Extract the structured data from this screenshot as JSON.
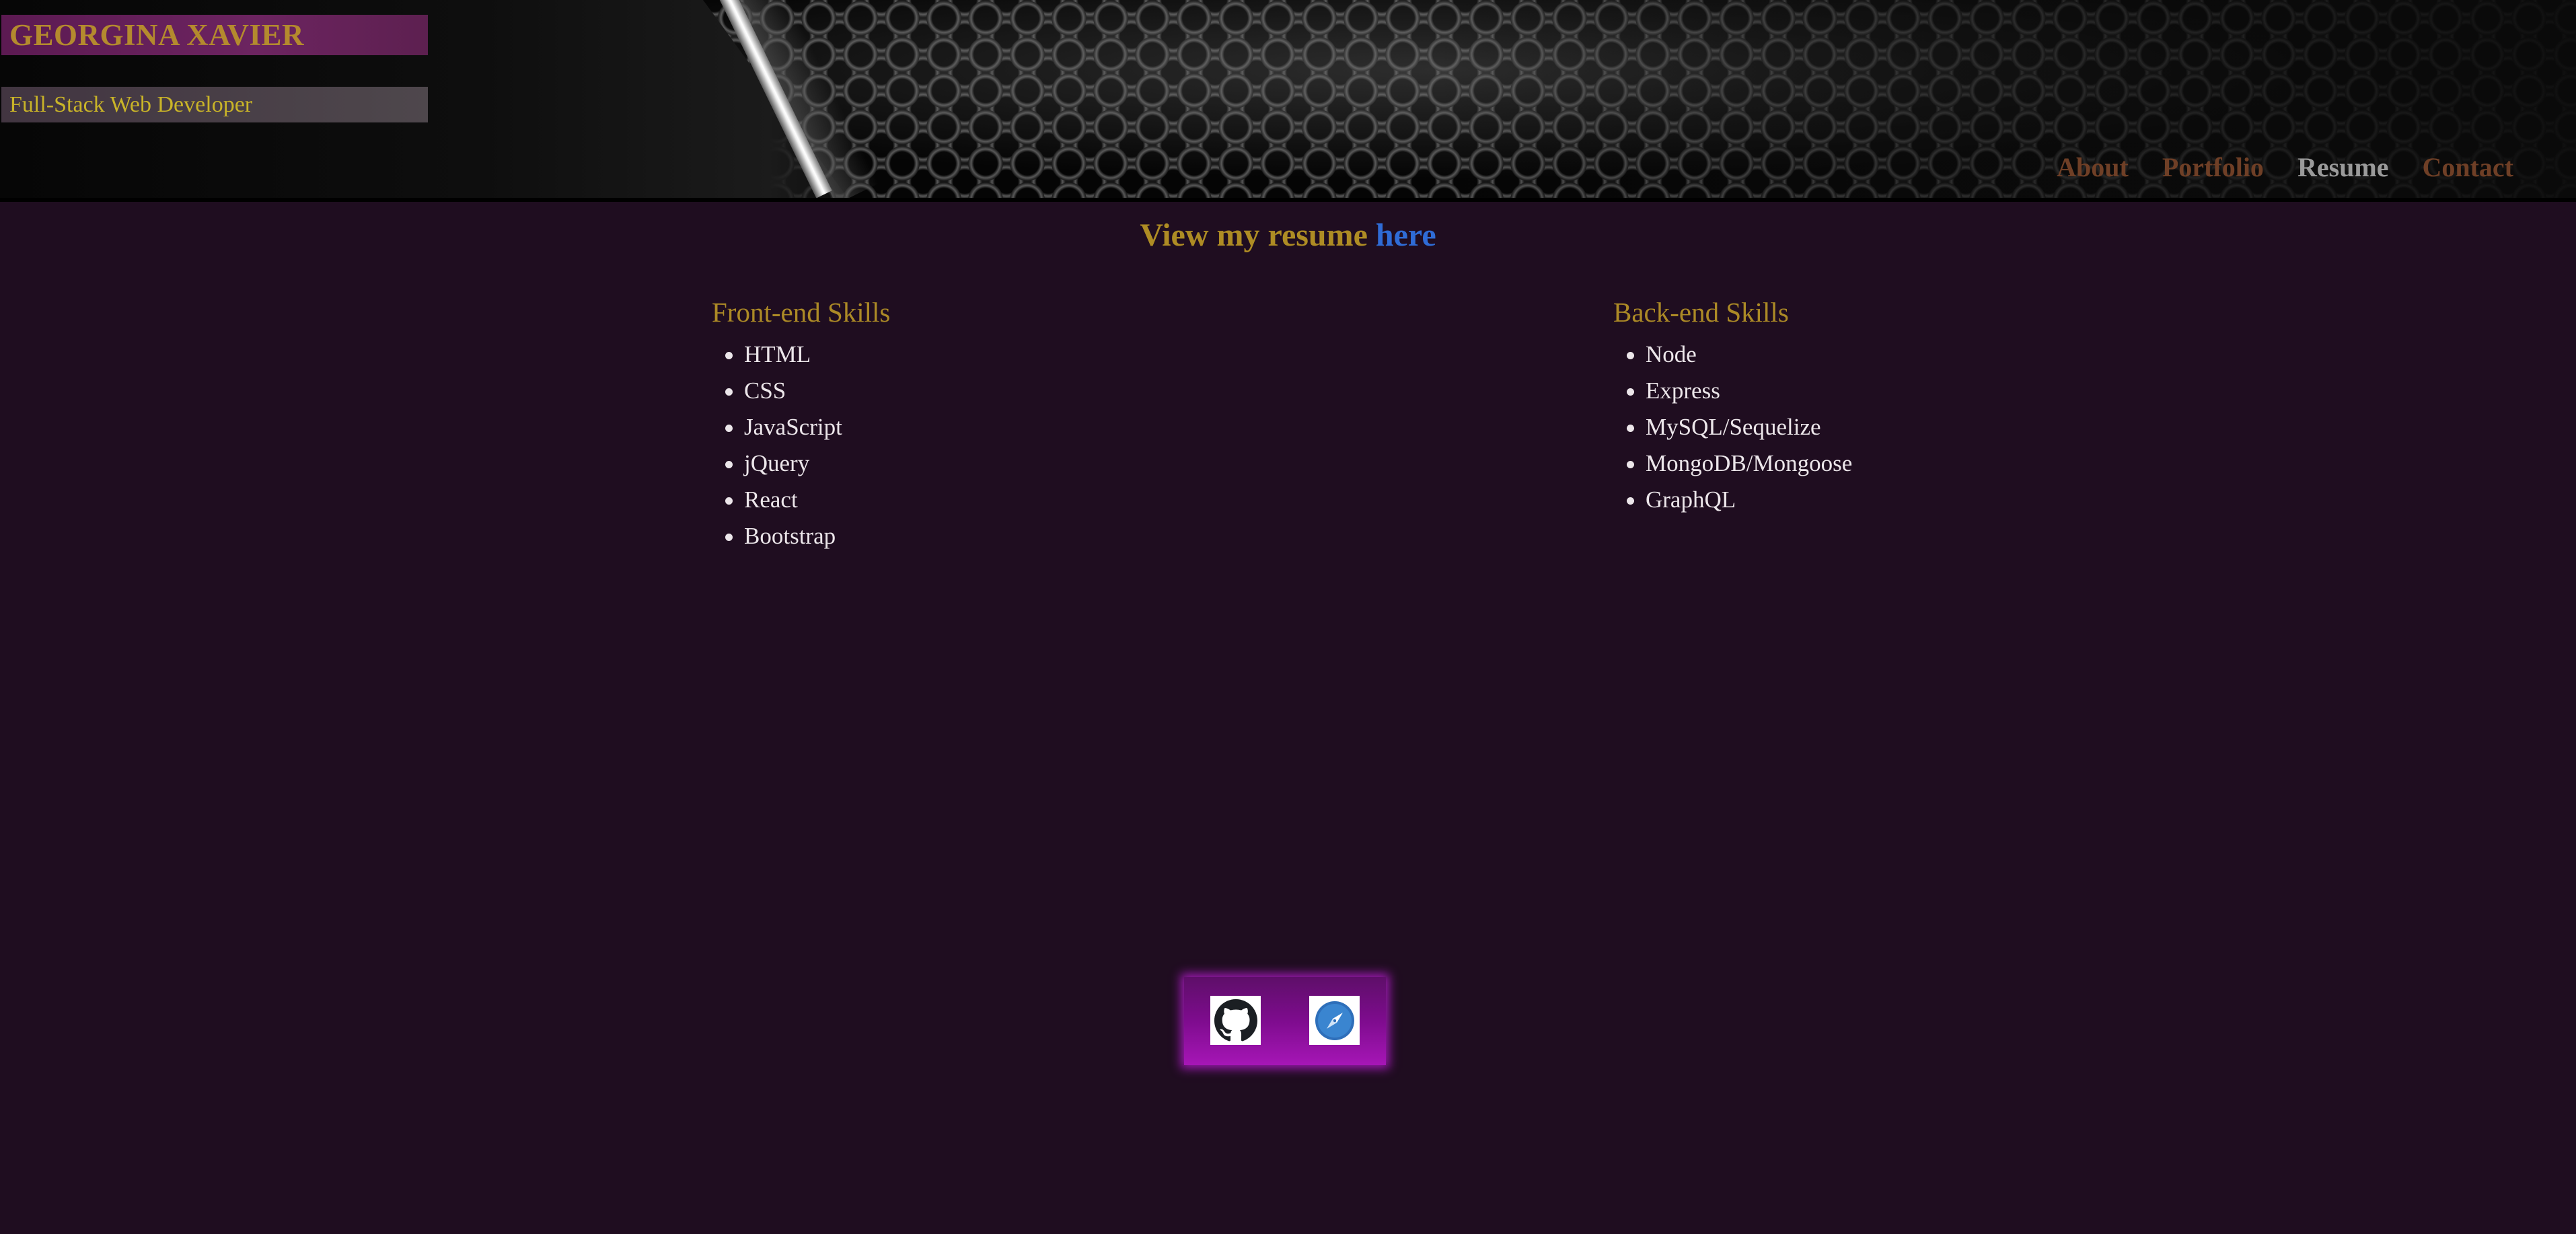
{
  "header": {
    "name": "GEORGINA XAVIER",
    "role": "Full-Stack Web Developer"
  },
  "nav": {
    "items": [
      {
        "label": "About"
      },
      {
        "label": "Portfolio"
      },
      {
        "label": "Resume",
        "active": true
      },
      {
        "label": "Contact"
      }
    ]
  },
  "resume": {
    "prefix": "View my resume ",
    "link_label": "here"
  },
  "skills": {
    "frontend": {
      "title": "Front-end Skills",
      "items": [
        "HTML",
        "CSS",
        "JavaScript",
        "jQuery",
        "React",
        "Bootstrap"
      ]
    },
    "backend": {
      "title": "Back-end Skills",
      "items": [
        "Node",
        "Express",
        "MySQL/Sequelize",
        "MongoDB/Mongoose",
        "GraphQL"
      ]
    }
  },
  "footer": {
    "icons": [
      "github-icon",
      "compass-icon"
    ]
  },
  "colors": {
    "background": "#1f0d20",
    "gold": "#ae8c24",
    "link_blue": "#2f6cd6",
    "nav_inactive": "#6f3f26",
    "nav_active": "#9a9a9a",
    "footer_purple": "#7e0c8e"
  }
}
